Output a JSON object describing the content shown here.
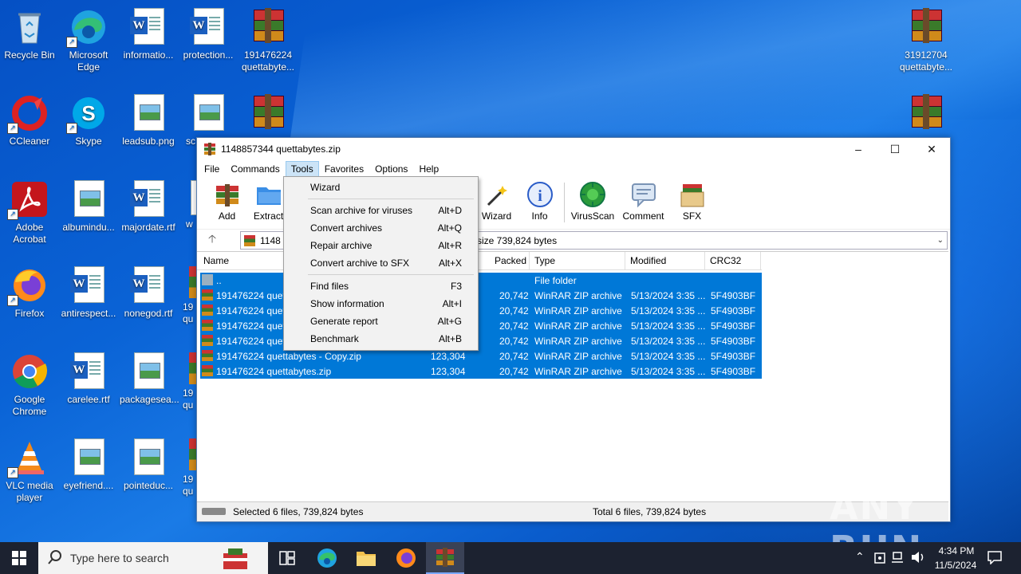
{
  "desktop": {
    "icons": [
      {
        "label": "Recycle Bin"
      },
      {
        "label": "Microsoft Edge"
      },
      {
        "label": "informatio..."
      },
      {
        "label": "protection..."
      },
      {
        "label": "191476224 quettabyte..."
      },
      {
        "label": "31912704 quettabyte..."
      },
      {
        "label": "CCleaner"
      },
      {
        "label": "Skype"
      },
      {
        "label": "leadsub.png"
      },
      {
        "label": "sc"
      },
      {
        "label": "Adobe Acrobat"
      },
      {
        "label": "albumindu..."
      },
      {
        "label": "majordate.rtf"
      },
      {
        "label": "w"
      },
      {
        "label": "Firefox"
      },
      {
        "label": "antirespect..."
      },
      {
        "label": "nonegod.rtf"
      },
      {
        "label": "19 qu"
      },
      {
        "label": "Google Chrome"
      },
      {
        "label": "carelee.rtf"
      },
      {
        "label": "packagesea..."
      },
      {
        "label": "19 qu"
      },
      {
        "label": "VLC media player"
      },
      {
        "label": "eyefriend...."
      },
      {
        "label": "pointeduc..."
      },
      {
        "label": "19 qu"
      }
    ]
  },
  "window": {
    "title": "1148857344 quettabytes.zip",
    "menu": [
      "File",
      "Commands",
      "Tools",
      "Favorites",
      "Options",
      "Help"
    ],
    "toolbar": {
      "add": "Add",
      "extract": "Extract",
      "wizard": "Wizard",
      "info": "Info",
      "virusscan": "VirusScan",
      "comment": "Comment",
      "sfx": "SFX"
    },
    "address": {
      "prefix": "1148",
      "suffix": "size 739,824 bytes"
    },
    "columns": {
      "name": "Name",
      "packed": "Packed",
      "type": "Type",
      "modified": "Modified",
      "crc": "CRC32"
    },
    "rows": [
      {
        "name": "..",
        "size": "",
        "packed": "",
        "type": "File folder",
        "modified": "",
        "crc": ""
      },
      {
        "name": "191476224 quett",
        "size": "",
        "packed": "20,742",
        "type": "WinRAR ZIP archive",
        "modified": "5/13/2024 3:35 ...",
        "crc": "5F4903BF"
      },
      {
        "name": "191476224 quett",
        "size": "",
        "packed": "20,742",
        "type": "WinRAR ZIP archive",
        "modified": "5/13/2024 3:35 ...",
        "crc": "5F4903BF"
      },
      {
        "name": "191476224 quett",
        "size": "",
        "packed": "20,742",
        "type": "WinRAR ZIP archive",
        "modified": "5/13/2024 3:35 ...",
        "crc": "5F4903BF"
      },
      {
        "name": "191476224 quett",
        "size": "",
        "packed": "20,742",
        "type": "WinRAR ZIP archive",
        "modified": "5/13/2024 3:35 ...",
        "crc": "5F4903BF"
      },
      {
        "name": "191476224 quettabytes - Copy.zip",
        "size": "123,304",
        "packed": "20,742",
        "type": "WinRAR ZIP archive",
        "modified": "5/13/2024 3:35 ...",
        "crc": "5F4903BF"
      },
      {
        "name": "191476224 quettabytes.zip",
        "size": "123,304",
        "packed": "20,742",
        "type": "WinRAR ZIP archive",
        "modified": "5/13/2024 3:35 ...",
        "crc": "5F4903BF"
      }
    ],
    "status": {
      "left": "Selected 6 files, 739,824 bytes",
      "right": "Total 6 files, 739,824 bytes"
    }
  },
  "tools_menu": {
    "items": [
      {
        "label": "Wizard",
        "key": ""
      },
      {
        "label": "Scan archive for viruses",
        "key": "Alt+D"
      },
      {
        "label": "Convert archives",
        "key": "Alt+Q"
      },
      {
        "label": "Repair archive",
        "key": "Alt+R"
      },
      {
        "label": "Convert archive to SFX",
        "key": "Alt+X"
      },
      {
        "label": "Find files",
        "key": "F3"
      },
      {
        "label": "Show information",
        "key": "Alt+I"
      },
      {
        "label": "Generate report",
        "key": "Alt+G"
      },
      {
        "label": "Benchmark",
        "key": "Alt+B"
      }
    ]
  },
  "taskbar": {
    "search_placeholder": "Type here to search",
    "time": "4:34 PM",
    "date": "11/5/2024"
  },
  "watermark": "ANY RUN",
  "colors": {
    "selection": "#0078d7",
    "desktop": "#0a5fd0",
    "taskbar": "#1c2230"
  }
}
